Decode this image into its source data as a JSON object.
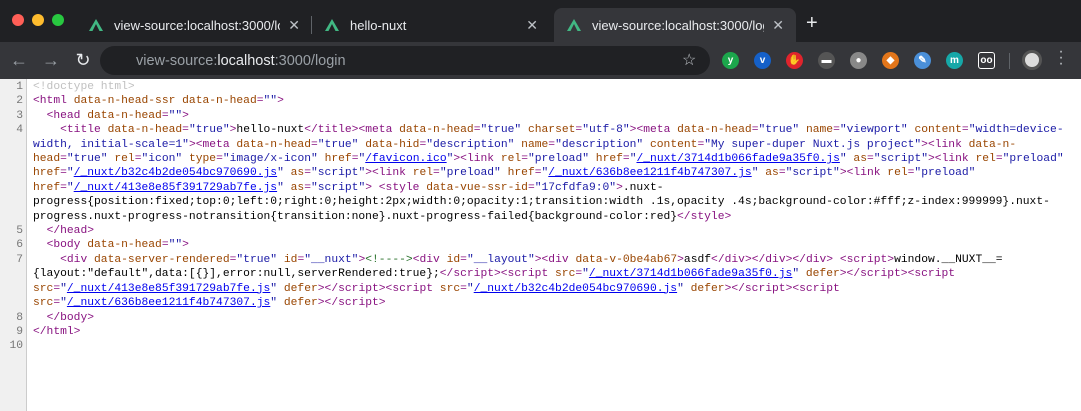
{
  "tabs": [
    {
      "title": "view-source:localhost:3000/login",
      "active": false
    },
    {
      "title": "hello-nuxt",
      "active": false
    },
    {
      "title": "view-source:localhost:3000/login",
      "active": true
    }
  ],
  "toolbar": {
    "url_scheme": "view-source:",
    "url_host": "localhost",
    "url_path": ":3000/login",
    "new_tab": "+"
  },
  "extensions": [
    {
      "name": "yoroi-icon",
      "color": "#1ca64c",
      "glyph": "y"
    },
    {
      "name": "vimeo-icon",
      "color": "#1560c8",
      "glyph": "v"
    },
    {
      "name": "adblock-icon",
      "color": "#e0242c",
      "glyph": "✋"
    },
    {
      "name": "incognito-ext-icon",
      "color": "#555555",
      "glyph": "▬"
    },
    {
      "name": "status-dot-icon",
      "color": "#888888",
      "glyph": "●"
    },
    {
      "name": "metamask-icon",
      "color": "#e2761b",
      "glyph": "◆"
    },
    {
      "name": "screenshot-icon",
      "color": "#4a8fd8",
      "glyph": "✎"
    },
    {
      "name": "m-ext-icon",
      "color": "#16a8a8",
      "glyph": "m"
    },
    {
      "name": "oo-ext-icon",
      "color": "#35363a",
      "glyph": "oo"
    }
  ],
  "lines": [
    [
      [
        "d",
        "<!doctype html>"
      ]
    ],
    [
      [
        "t",
        "<html "
      ],
      [
        "a",
        "data-n-head-ssr data-n-head"
      ],
      [
        "e",
        "="
      ],
      [
        "v",
        "\"\""
      ],
      [
        "t",
        ">"
      ]
    ],
    [
      [
        "x",
        "  "
      ],
      [
        "t",
        "<head "
      ],
      [
        "a",
        "data-n-head"
      ],
      [
        "e",
        "="
      ],
      [
        "v",
        "\"\""
      ],
      [
        "t",
        ">"
      ]
    ],
    [
      [
        "x",
        "    "
      ],
      [
        "t",
        "<title "
      ],
      [
        "a",
        "data-n-head"
      ],
      [
        "e",
        "="
      ],
      [
        "v",
        "\"true\""
      ],
      [
        "t",
        ">"
      ],
      [
        "x",
        "hello-nuxt"
      ],
      [
        "t",
        "</title><meta "
      ],
      [
        "a",
        "data-n-head"
      ],
      [
        "e",
        "="
      ],
      [
        "v",
        "\"true\""
      ],
      [
        "a",
        " charset"
      ],
      [
        "e",
        "="
      ],
      [
        "v",
        "\"utf-8\""
      ],
      [
        "t",
        "><meta "
      ],
      [
        "a",
        "data-n-head"
      ],
      [
        "e",
        "="
      ],
      [
        "v",
        "\"true\""
      ],
      [
        "a",
        " name"
      ],
      [
        "e",
        "="
      ],
      [
        "v",
        "\"viewport\""
      ],
      [
        "a",
        " content"
      ],
      [
        "e",
        "="
      ],
      [
        "v",
        "\"width=device-width, initial-scale=1\""
      ],
      [
        "t",
        "><meta "
      ],
      [
        "a",
        "data-n-head"
      ],
      [
        "e",
        "="
      ],
      [
        "v",
        "\"true\""
      ],
      [
        "a",
        " data-hid"
      ],
      [
        "e",
        "="
      ],
      [
        "v",
        "\"description\""
      ],
      [
        "a",
        " name"
      ],
      [
        "e",
        "="
      ],
      [
        "v",
        "\"description\""
      ],
      [
        "a",
        " content"
      ],
      [
        "e",
        "="
      ],
      [
        "v",
        "\"My super-duper Nuxt.js project\""
      ],
      [
        "t",
        "><link "
      ],
      [
        "a",
        "data-n-head"
      ],
      [
        "e",
        "="
      ],
      [
        "v",
        "\"true\""
      ],
      [
        "a",
        " rel"
      ],
      [
        "e",
        "="
      ],
      [
        "v",
        "\"icon\""
      ],
      [
        "a",
        " type"
      ],
      [
        "e",
        "="
      ],
      [
        "v",
        "\"image/x-icon\""
      ],
      [
        "a",
        " href"
      ],
      [
        "e",
        "="
      ],
      [
        "v",
        "\""
      ],
      [
        "l",
        "/favicon.ico"
      ],
      [
        "v",
        "\""
      ],
      [
        "t",
        "><link "
      ],
      [
        "a",
        "rel"
      ],
      [
        "e",
        "="
      ],
      [
        "v",
        "\"preload\""
      ],
      [
        "a",
        " href"
      ],
      [
        "e",
        "="
      ],
      [
        "v",
        "\""
      ],
      [
        "l",
        "/_nuxt/3714d1b066fade9a35f0.js"
      ],
      [
        "v",
        "\""
      ],
      [
        "a",
        " as"
      ],
      [
        "e",
        "="
      ],
      [
        "v",
        "\"script\""
      ],
      [
        "t",
        "><link "
      ],
      [
        "a",
        "rel"
      ],
      [
        "e",
        "="
      ],
      [
        "v",
        "\"preload\""
      ],
      [
        "a",
        " href"
      ],
      [
        "e",
        "="
      ],
      [
        "v",
        "\""
      ],
      [
        "l",
        "/_nuxt/b32c4b2de054bc970690.js"
      ],
      [
        "v",
        "\""
      ],
      [
        "a",
        " as"
      ],
      [
        "e",
        "="
      ],
      [
        "v",
        "\"script\""
      ],
      [
        "t",
        "><link "
      ],
      [
        "a",
        "rel"
      ],
      [
        "e",
        "="
      ],
      [
        "v",
        "\"preload\""
      ],
      [
        "a",
        " href"
      ],
      [
        "e",
        "="
      ],
      [
        "v",
        "\""
      ],
      [
        "l",
        "/_nuxt/636b8ee1211f4b747307.js"
      ],
      [
        "v",
        "\""
      ],
      [
        "a",
        " as"
      ],
      [
        "e",
        "="
      ],
      [
        "v",
        "\"script\""
      ],
      [
        "t",
        "><link "
      ],
      [
        "a",
        "rel"
      ],
      [
        "e",
        "="
      ],
      [
        "v",
        "\"preload\""
      ],
      [
        "a",
        " href"
      ],
      [
        "e",
        "="
      ],
      [
        "v",
        "\""
      ],
      [
        "l",
        "/_nuxt/413e8e85f391729ab7fe.js"
      ],
      [
        "v",
        "\""
      ],
      [
        "a",
        " as"
      ],
      [
        "e",
        "="
      ],
      [
        "v",
        "\"script\""
      ],
      [
        "t",
        "> <style "
      ],
      [
        "a",
        "data-vue-ssr-id"
      ],
      [
        "e",
        "="
      ],
      [
        "v",
        "\"17cfdfa9:0\""
      ],
      [
        "t",
        ">"
      ],
      [
        "x",
        ".nuxt-progress{position:fixed;top:0;left:0;right:0;height:2px;width:0;opacity:1;transition:width .1s,opacity .4s;background-color:#fff;z-index:999999}.nuxt-progress.nuxt-progress-notransition{transition:none}.nuxt-progress-failed{background-color:red}"
      ],
      [
        "t",
        "</style>"
      ]
    ],
    [
      [
        "x",
        "  "
      ],
      [
        "t",
        "</head>"
      ]
    ],
    [
      [
        "x",
        "  "
      ],
      [
        "t",
        "<body "
      ],
      [
        "a",
        "data-n-head"
      ],
      [
        "e",
        "="
      ],
      [
        "v",
        "\"\""
      ],
      [
        "t",
        ">"
      ]
    ],
    [
      [
        "x",
        "    "
      ],
      [
        "t",
        "<div "
      ],
      [
        "a",
        "data-server-rendered"
      ],
      [
        "e",
        "="
      ],
      [
        "v",
        "\"true\""
      ],
      [
        "a",
        " id"
      ],
      [
        "e",
        "="
      ],
      [
        "v",
        "\"__nuxt\""
      ],
      [
        "t",
        ">"
      ],
      [
        "c",
        "<!---->"
      ],
      [
        "t",
        "<div "
      ],
      [
        "a",
        "id"
      ],
      [
        "e",
        "="
      ],
      [
        "v",
        "\"__layout\""
      ],
      [
        "t",
        "><div "
      ],
      [
        "a",
        "data-v-0be4ab67"
      ],
      [
        "t",
        ">"
      ],
      [
        "x",
        "asdf"
      ],
      [
        "t",
        "</div></div></div> <script>"
      ],
      [
        "x",
        "window.__NUXT__={layout:\"default\",data:[{}],error:null,serverRendered:true};"
      ],
      [
        "t",
        "</script><script "
      ],
      [
        "a",
        "src"
      ],
      [
        "e",
        "="
      ],
      [
        "v",
        "\""
      ],
      [
        "l",
        "/_nuxt/3714d1b066fade9a35f0.js"
      ],
      [
        "v",
        "\""
      ],
      [
        "a",
        " defer"
      ],
      [
        "t",
        "></script><script "
      ],
      [
        "a",
        "src"
      ],
      [
        "e",
        "="
      ],
      [
        "v",
        "\""
      ],
      [
        "l",
        "/_nuxt/413e8e85f391729ab7fe.js"
      ],
      [
        "v",
        "\""
      ],
      [
        "a",
        " defer"
      ],
      [
        "t",
        "></script><script "
      ],
      [
        "a",
        "src"
      ],
      [
        "e",
        "="
      ],
      [
        "v",
        "\""
      ],
      [
        "l",
        "/_nuxt/b32c4b2de054bc970690.js"
      ],
      [
        "v",
        "\""
      ],
      [
        "a",
        " defer"
      ],
      [
        "t",
        "></script><script "
      ],
      [
        "a",
        "src"
      ],
      [
        "e",
        "="
      ],
      [
        "v",
        "\""
      ],
      [
        "l",
        "/_nuxt/636b8ee1211f4b747307.js"
      ],
      [
        "v",
        "\""
      ],
      [
        "a",
        " defer"
      ],
      [
        "t",
        "></script>"
      ]
    ],
    [
      [
        "x",
        "  "
      ],
      [
        "t",
        "</body>"
      ]
    ],
    [
      [
        "t",
        "</html>"
      ]
    ],
    []
  ]
}
